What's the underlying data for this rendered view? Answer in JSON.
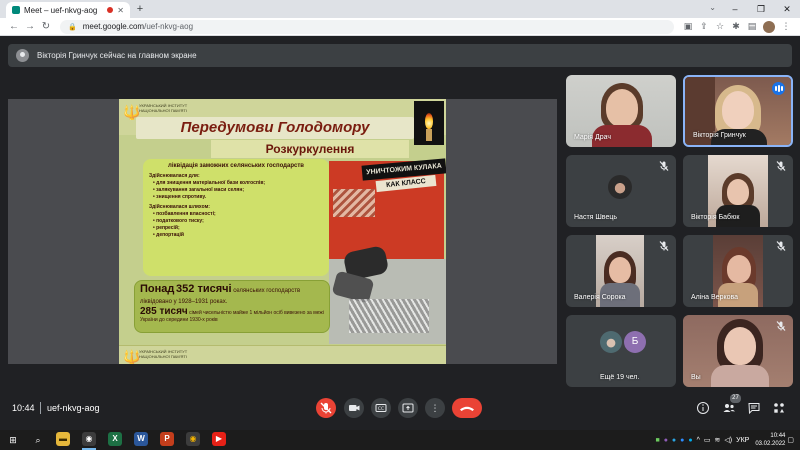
{
  "browser": {
    "tab_title": "Meet – uef-nkvg-aog",
    "new_tab_symbol": "+",
    "url_host": "meet.google.com",
    "url_path": "/uef-nkvg-aog"
  },
  "banner": {
    "text": "Вікторія Гринчук сейчас на главном экране"
  },
  "slide": {
    "institute": "УКРАЇНСЬКИЙ ІНСТИТУТ НАЦІОНАЛЬНОЇ ПАМ'ЯТІ",
    "title": "Передумови Голодомору",
    "subtitle": "Розкуркулення",
    "box_heading": "ліквідація заможних селянських господарств",
    "done_for": "Здійснювалася для:",
    "done_for_items": [
      "для знищення матеріальної бази колгоспів;",
      "залякування загальної маси селян;",
      "знищення спротиву."
    ],
    "done_by": "Здійснювалася шляхом:",
    "done_by_items": [
      "позбавлення власності;",
      "податкового тиску;",
      "репресій;",
      "депортацій"
    ],
    "poster_line1": "УНИЧТОЖИМ КУЛАКА",
    "poster_line2": "КАК КЛАСС",
    "stat1_prefix": "Понад",
    "stat1_big": "352 тисячі",
    "stat1_rest": "селянських господарств ліквідовано у 1928–1931 роках.",
    "stat2_big": "285 тисяч",
    "stat2_rest": "сімей чисельністю майже 1 мільйон осіб вивезено за межі України до середини 1930-х років"
  },
  "participants": [
    {
      "name": "Марія Драч",
      "muted": false
    },
    {
      "name": "Вікторія Гринчук",
      "muted": false,
      "speaking": true
    },
    {
      "name": "Настя Швець",
      "muted": true
    },
    {
      "name": "Вікторія Бабюк",
      "muted": true
    },
    {
      "name": "Валерія Сорока",
      "muted": true
    },
    {
      "name": "Аліна Веркова",
      "muted": true
    },
    {
      "name": "Ещё 19 чел.",
      "muted": false,
      "avatar_letter": "Б"
    },
    {
      "name": "Вы",
      "muted": true
    }
  ],
  "bottom": {
    "time": "10:44",
    "separator": "|",
    "meeting_code": "uef-nkvg-aog",
    "people_count": "27"
  },
  "taskbar": {
    "lang": "УКР",
    "time": "10:44",
    "date": "03.02.2022"
  },
  "colors": {
    "meet_bg": "#202124",
    "tile_bg": "#3c4043",
    "leave_red": "#ea4335",
    "active_border": "#8ab4f8"
  }
}
